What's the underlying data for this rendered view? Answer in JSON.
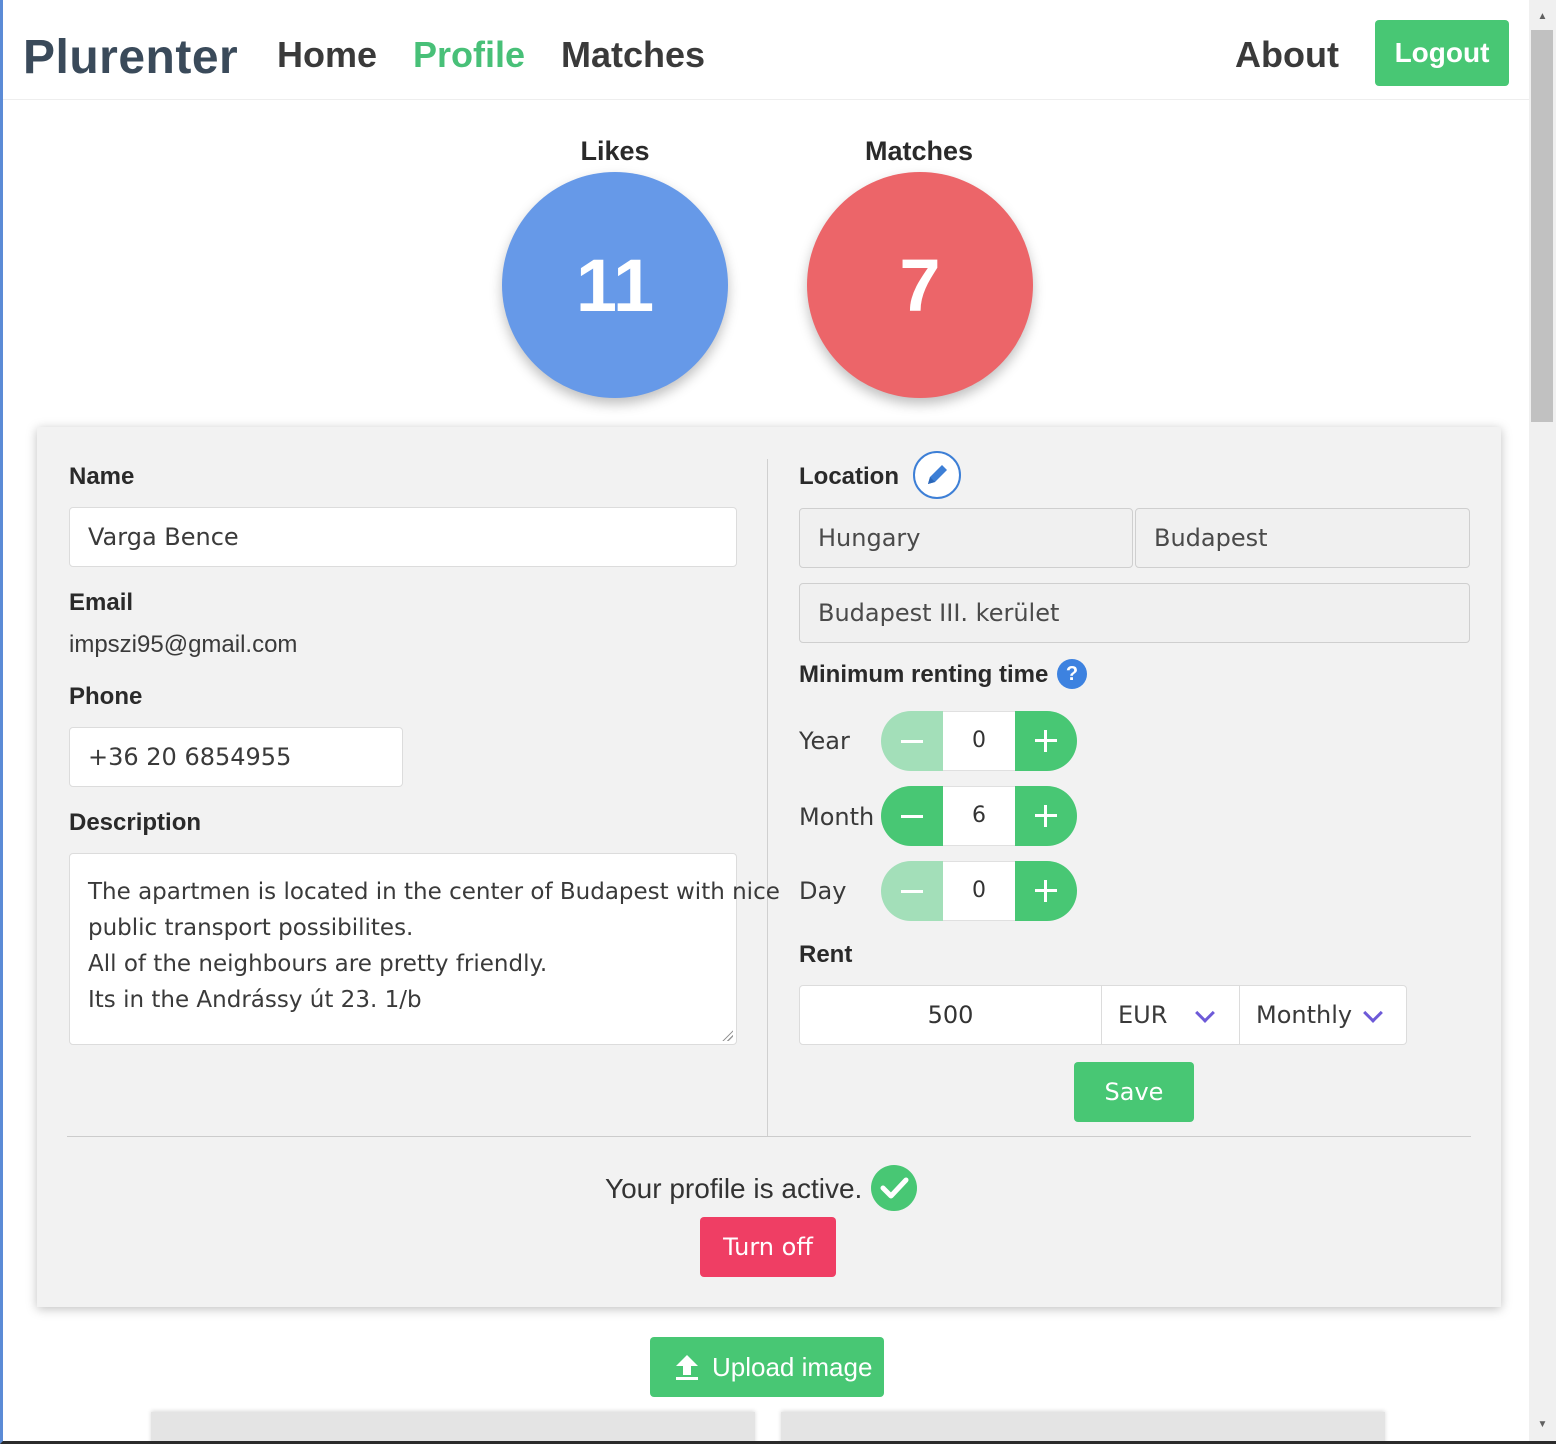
{
  "navbar": {
    "brand": "Plurenter",
    "links": {
      "home": "Home",
      "profile": "Profile",
      "matches": "Matches",
      "about": "About"
    },
    "logout_label": "Logout"
  },
  "stats": {
    "likes_label": "Likes",
    "likes_value": "11",
    "matches_label": "Matches",
    "matches_value": "7",
    "likes_color": "#6699e8",
    "matches_color": "#ec6569"
  },
  "profile": {
    "name_label": "Name",
    "name_value": "Varga Bence",
    "email_label": "Email",
    "email_value": "impszi95@gmail.com",
    "phone_label": "Phone",
    "phone_value": "+36 20 6854955",
    "description_label": "Description",
    "description_lines": [
      "The apartmen is located in the center of Budapest with nice",
      "public transport possibilites.",
      "All of the neighbours are pretty friendly.",
      "Its in the Andrássy út 23. 1/b"
    ]
  },
  "location": {
    "label": "Location",
    "country": "Hungary",
    "city": "Budapest",
    "district": "Budapest III. kerület"
  },
  "renting_time": {
    "label": "Minimum renting time",
    "help_icon": "?",
    "year_label": "Year",
    "year_value": "0",
    "month_label": "Month",
    "month_value": "6",
    "day_label": "Day",
    "day_value": "0"
  },
  "rent": {
    "label": "Rent",
    "amount": "500",
    "currency": "EUR",
    "period": "Monthly"
  },
  "save_label": "Save",
  "status": {
    "text": "Your profile is active.",
    "turn_off_label": "Turn off"
  },
  "upload_label": "Upload image",
  "colors": {
    "accent_green": "#48c774",
    "danger": "#ef3e64",
    "link_blue": "#3d82e0"
  }
}
